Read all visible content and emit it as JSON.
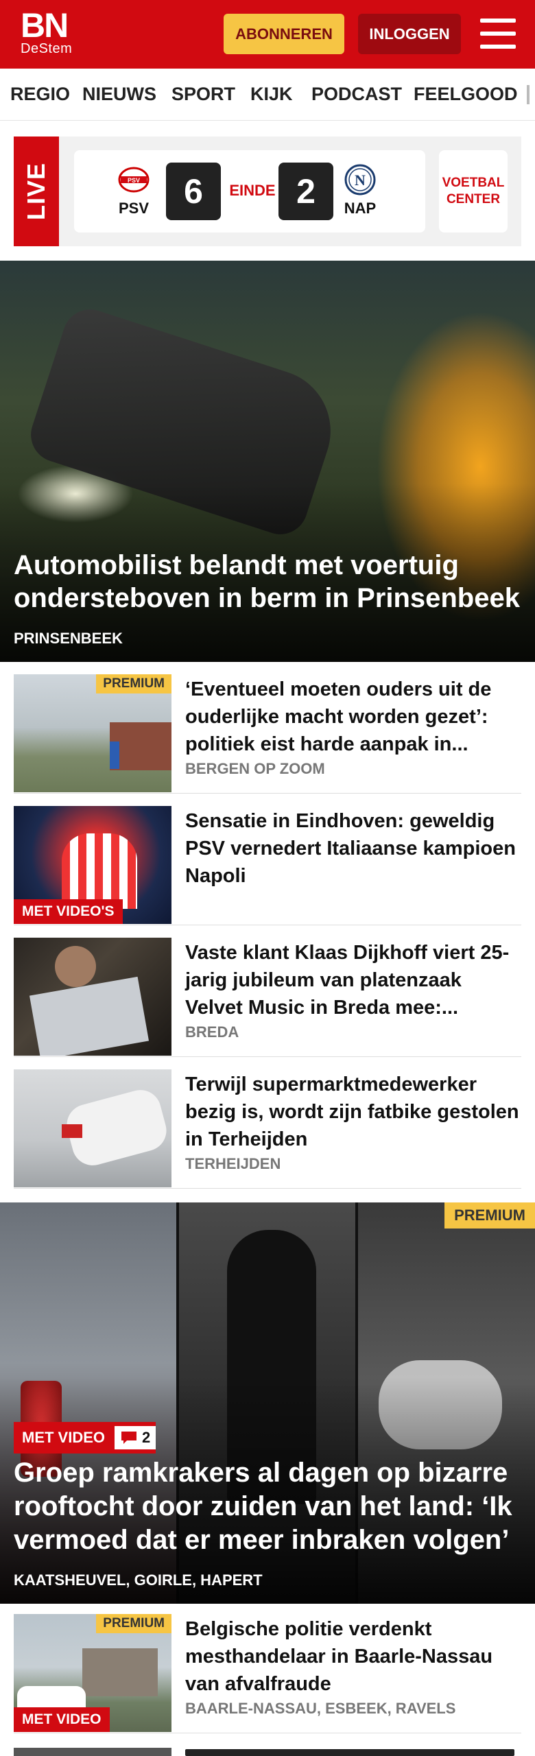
{
  "header": {
    "logo_main": "BN",
    "logo_sub": "DeStem",
    "subscribe_label": "ABONNEREN",
    "login_label": "INLOGGEN"
  },
  "nav": {
    "items": [
      "REGIO",
      "NIEUWS",
      "SPORT",
      "KIJK",
      "PODCAST",
      "FEELGOOD"
    ]
  },
  "live": {
    "label": "LIVE",
    "home_team": "PSV",
    "away_team": "NAP",
    "home_score": "6",
    "away_score": "2",
    "status": "EINDE",
    "home_crest_text": "PSV",
    "away_crest_text": "N",
    "voetbal_center_label": "VOETBAL CENTER"
  },
  "hero": {
    "title": "Automobilist belandt met voertuig ondersteboven in berm in Prinsenbeek",
    "location": "PRINSENBEEK"
  },
  "articles": [
    {
      "title": "‘Eventueel moeten ouders uit de ouderlijke macht worden gezet’: politiek eist harde aanpak in...",
      "location": "BERGEN OP ZOOM",
      "badge": "PREMIUM"
    },
    {
      "title": "Sensatie in Eindhoven: geweldig PSV vernedert Italiaanse kampioen Napoli",
      "location": "",
      "badge": "MET VIDEO'S"
    },
    {
      "title": "Vaste klant Klaas Dijkhoff viert 25-jarig jubileum van platenzaak Velvet Music in Breda mee:...",
      "location": "BREDA",
      "badge": ""
    },
    {
      "title": "Terwijl supermarktmedewerker bezig is, wordt zijn fatbike gestolen in Terheijden",
      "location": "TERHEIJDEN",
      "badge": ""
    }
  ],
  "big_video": {
    "premium_badge": "PREMIUM",
    "video_badge": "MET VIDEO",
    "comment_count": "2",
    "title": "Groep ramkrakers al dagen op bizarre rooftocht door zuiden van het land: ‘Ik vermoed dat er meer inbraken volgen’",
    "location": "KAATSHEUVEL, GOIRLE, HAPERT"
  },
  "last_article": {
    "title": "Belgische politie verdenkt mesthandelaar in Baarle-Nassau van afvalfraude",
    "location": "BAARLE-NASSAU, ESBEEK, RAVELS",
    "premium_badge": "PREMIUM",
    "video_badge": "MET VIDEO"
  },
  "colors": {
    "brand_red": "#d10a11",
    "premium_yellow": "#f6c544",
    "dark_red": "#9e0a10"
  }
}
